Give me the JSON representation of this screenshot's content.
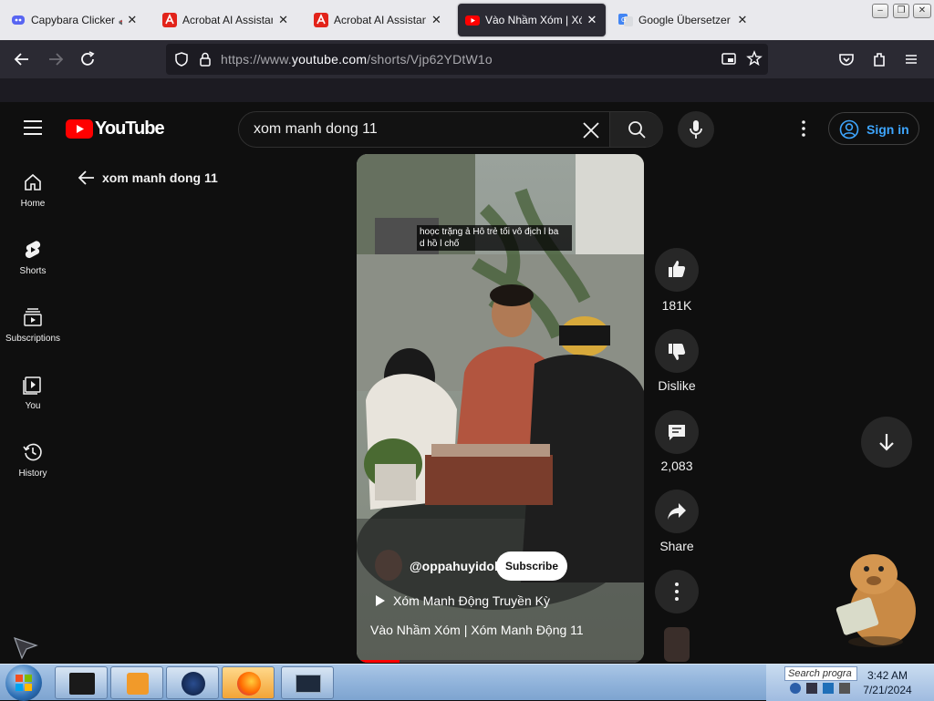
{
  "browser": {
    "tabs": [
      {
        "title": "Capybara Clicker 🕹️",
        "favicon": "discord-like-icon",
        "active": false
      },
      {
        "title": "Acrobat AI Assistant",
        "favicon": "acrobat-icon",
        "active": false
      },
      {
        "title": "Acrobat AI Assistant",
        "favicon": "acrobat-icon",
        "active": false
      },
      {
        "title": "Vào Nhầm Xóm | Xóm",
        "favicon": "youtube-icon",
        "active": true
      },
      {
        "title": "Google Übersetzer",
        "favicon": "google-translate-icon",
        "active": false
      }
    ],
    "url_prefix": "https://www.",
    "url_host": "youtube.com",
    "url_path": "/shorts/Vjp62YDtW1o",
    "close_glyph": "✕"
  },
  "youtube": {
    "logo_text": "YouTube",
    "search_value": "xom manh dong 11",
    "sign_in_label": "Sign in",
    "back_title": "xom manh dong 11",
    "rail": [
      {
        "label": "Home",
        "icon": "home-icon"
      },
      {
        "label": "Shorts",
        "icon": "shorts-icon"
      },
      {
        "label": "Subscriptions",
        "icon": "subscriptions-icon"
      },
      {
        "label": "You",
        "icon": "you-icon"
      },
      {
        "label": "History",
        "icon": "history-icon"
      }
    ]
  },
  "short": {
    "caption_line1": "hoọc trặng ả Hô trẻ tối vô địch l ba",
    "caption_line2": "d hồ l chố",
    "channel": "@oppahuyidol",
    "subscribe_label": "Subscribe",
    "playlist_label": "Xóm Manh Động Truyền Kỳ",
    "video_title": "Vào Nhầm Xóm | Xóm Manh Động 11",
    "likes": "181K",
    "dislike_label": "Dislike",
    "comments": "2,083",
    "share_label": "Share",
    "progress": 0.15
  },
  "colors": {
    "yt_red": "#ff0000",
    "link_blue": "#3ea6ff",
    "bg": "#0f0f0f",
    "btn_bg": "#272727"
  },
  "taskbar": {
    "search_placeholder": "Search progra",
    "time": "3:42 AM",
    "date": "7/21/2024"
  }
}
